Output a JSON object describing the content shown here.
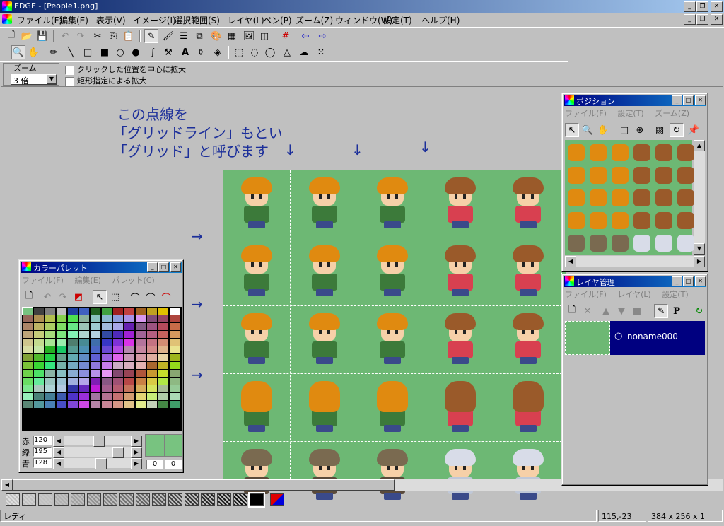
{
  "window": {
    "title": "EDGE - [People1.png]"
  },
  "menu": [
    "ファイル(F)",
    "編集(E)",
    "表示(V)",
    "イメージ(I)",
    "選択範囲(S)",
    "レイヤ(L)",
    "ペン(P)",
    "ズーム(Z)",
    "ウィンドウ(W)",
    "設定(T)",
    "ヘルプ(H)"
  ],
  "zoom": {
    "label": "ズーム",
    "value": "3 倍",
    "options": [
      "クリックした位置を中心に拡大",
      "矩形指定による拡大"
    ]
  },
  "annotation": {
    "line1": "この点線を",
    "line2": "「グリッドライン」もとい",
    "line3": "「グリッド」と呼びます",
    "down_arrow": "↓",
    "right_arrow": "→"
  },
  "position_panel": {
    "title": "ポジション",
    "menu": [
      "ファイル(F)",
      "設定(T)",
      "ズーム(Z)"
    ]
  },
  "layer_panel": {
    "title": "レイヤ管理",
    "menu": [
      "ファイル(F)",
      "レイヤ(L)",
      "設定(T)"
    ],
    "layer_name": "noname000",
    "p_label": "P"
  },
  "palette_panel": {
    "title": "カラーパレット",
    "menu": [
      "ファイル(F)",
      "編集(E)",
      "パレット(C)"
    ],
    "sliders": [
      {
        "label": "赤",
        "value": "120",
        "level": 0.47
      },
      {
        "label": "緑",
        "value": "195",
        "level": 0.76
      },
      {
        "label": "青",
        "value": "128",
        "level": 0.5
      }
    ],
    "counter_a": "0",
    "counter_b": "0"
  },
  "status": {
    "state": "レディ",
    "coords": "115,-23",
    "size": "384 x 256 x 1"
  },
  "colors": {
    "accent": "#000080",
    "sprite_bg": "#6db874",
    "annotation": "#1c2f9a"
  }
}
